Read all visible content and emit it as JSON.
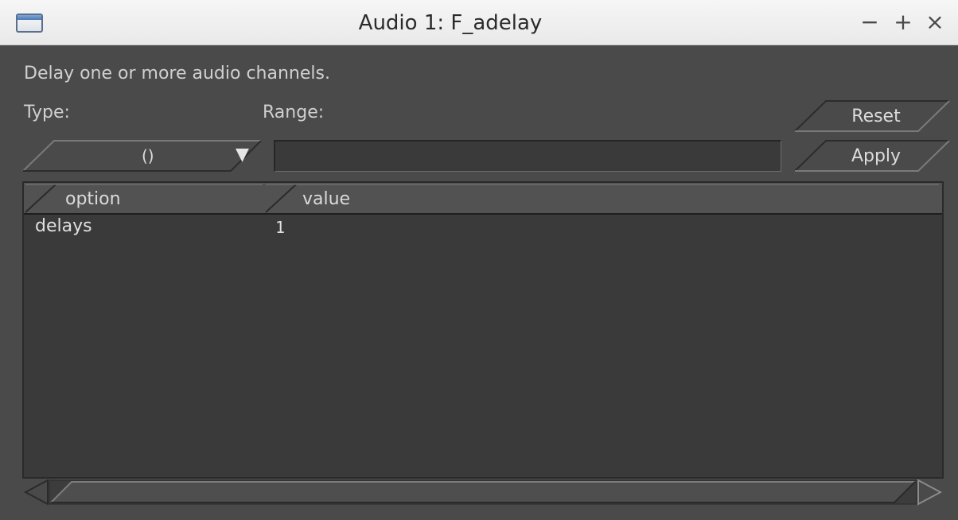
{
  "window": {
    "title": "Audio 1: F_adelay",
    "minimize": "−",
    "maximize": "+",
    "close": "×"
  },
  "description": "Delay one or more audio channels.",
  "labels": {
    "type": "Type:",
    "range": "Range:"
  },
  "buttons": {
    "reset": "Reset",
    "apply": "Apply"
  },
  "type_select": {
    "value": "()",
    "arrow": "▼"
  },
  "range_input": {
    "value": ""
  },
  "table": {
    "columns": [
      "option",
      "value"
    ],
    "rows": [
      {
        "option": "delays",
        "value": "1"
      }
    ]
  }
}
